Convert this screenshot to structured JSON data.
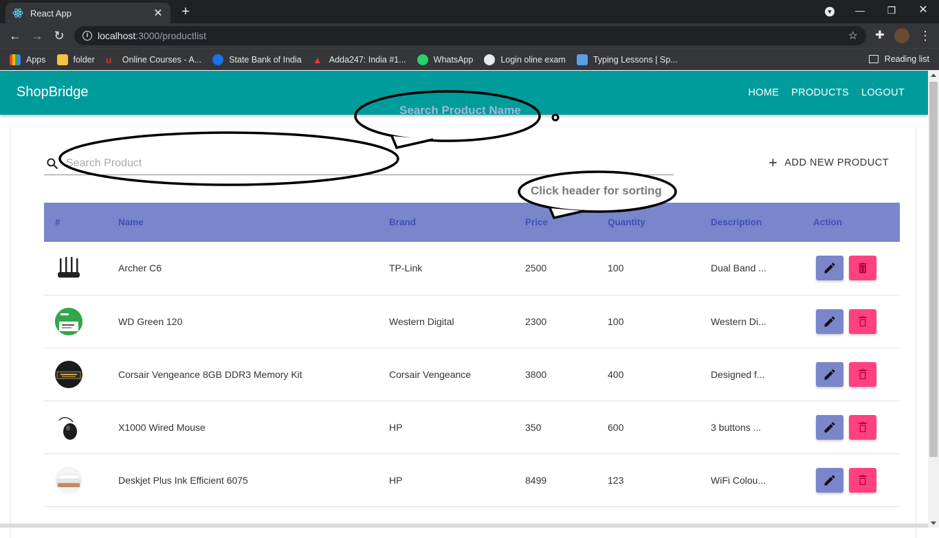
{
  "browser": {
    "tab_title": "React App",
    "url_host": "localhost",
    "url_path": ":3000/productlist",
    "bookmarks": [
      {
        "label": "Apps",
        "color": "#4285f4"
      },
      {
        "label": "folder",
        "color": "#f6c343"
      },
      {
        "label": "Online Courses - A...",
        "color": "#d93025"
      },
      {
        "label": "State Bank of India",
        "color": "#1a73e8"
      },
      {
        "label": "Adda247: India #1...",
        "color": "#e53935"
      },
      {
        "label": "WhatsApp",
        "color": "#25d366"
      },
      {
        "label": "Login oline exam",
        "color": "#e8eaed"
      },
      {
        "label": "Typing Lessons | Sp...",
        "color": "#5c9ee6"
      }
    ],
    "reading_list": "Reading list"
  },
  "app": {
    "brand": "ShopBridge",
    "nav": [
      "HOME",
      "PRODUCTS",
      "LOGOUT"
    ],
    "search_placeholder": "Search Product",
    "add_label": "ADD NEW PRODUCT",
    "annotations": {
      "search_hint": "Search Product Name",
      "sort_hint": "Click header for sorting"
    },
    "columns": [
      "#",
      "Name",
      "Brand",
      "Price",
      "Quantity",
      "Description",
      "Action"
    ],
    "rows": [
      {
        "name": "Archer C6",
        "brand": "TP-Link",
        "price": "2500",
        "quantity": "100",
        "description": "Dual Band ...",
        "image": "router-icon"
      },
      {
        "name": "WD Green 120",
        "brand": "Western Digital",
        "price": "2300",
        "quantity": "100",
        "description": "Western Di...",
        "image": "ssd-icon"
      },
      {
        "name": "Corsair Vengeance 8GB DDR3 Memory Kit",
        "brand": "Corsair Vengeance",
        "price": "3800",
        "quantity": "400",
        "description": "Designed f...",
        "image": "ram-icon"
      },
      {
        "name": "X1000 Wired Mouse",
        "brand": "HP",
        "price": "350",
        "quantity": "600",
        "description": "3 buttons ...",
        "image": "mouse-icon"
      },
      {
        "name": "Deskjet Plus Ink Efficient 6075",
        "brand": "HP",
        "price": "8499",
        "quantity": "123",
        "description": "WiFi Colou...",
        "image": "printer-icon"
      }
    ]
  },
  "colors": {
    "appbar": "#009c9c",
    "header_row": "#7986cb",
    "header_text": "#3f51b5",
    "edit": "#7986cb",
    "delete": "#ff4081"
  }
}
